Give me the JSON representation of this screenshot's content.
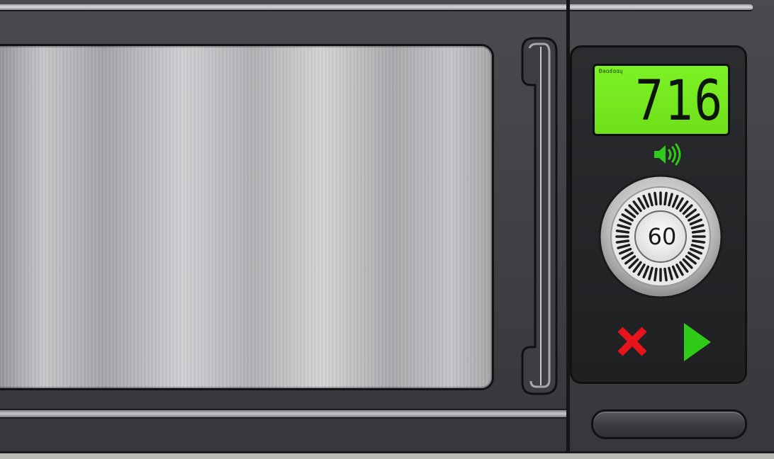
{
  "display": {
    "label": "Ɖəɑɗɑɑɥ",
    "time": "716",
    "background_color": "#76ea1f"
  },
  "controls": {
    "sound_icon": "speaker-volume-icon",
    "dial_value": "60",
    "cancel_icon": "x-cancel-icon",
    "cancel_color": "#e8141c",
    "start_icon": "play-triangle-icon",
    "start_color": "#2ecc18",
    "sound_color": "#2ecc18"
  },
  "appliance": {
    "body_color": "#414246",
    "window_color": "#bfc0c3"
  }
}
